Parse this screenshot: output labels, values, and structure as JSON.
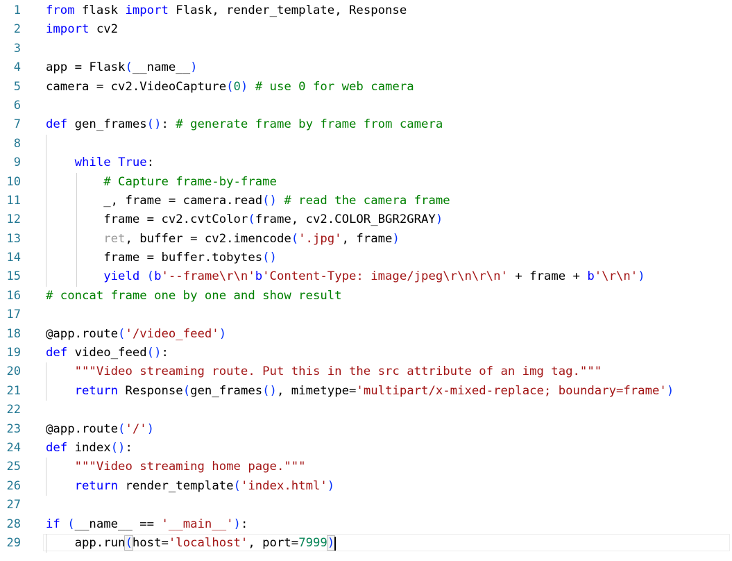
{
  "editor": {
    "lines": [
      {
        "n": "1",
        "indent": 0,
        "tokens": [
          {
            "t": "from",
            "c": "kw"
          },
          {
            "t": " flask ",
            "c": "pl"
          },
          {
            "t": "import",
            "c": "kw"
          },
          {
            "t": " Flask, render_template, Response",
            "c": "pl"
          }
        ]
      },
      {
        "n": "2",
        "indent": 0,
        "tokens": [
          {
            "t": "import",
            "c": "kw"
          },
          {
            "t": " cv2",
            "c": "pl"
          }
        ]
      },
      {
        "n": "3",
        "indent": 0,
        "tokens": []
      },
      {
        "n": "4",
        "indent": 0,
        "tokens": [
          {
            "t": "app = Flask",
            "c": "pl"
          },
          {
            "t": "(",
            "c": "br"
          },
          {
            "t": "__name__",
            "c": "pl"
          },
          {
            "t": ")",
            "c": "br"
          }
        ]
      },
      {
        "n": "5",
        "indent": 0,
        "tokens": [
          {
            "t": "camera = cv2.VideoCapture",
            "c": "pl"
          },
          {
            "t": "(",
            "c": "br"
          },
          {
            "t": "0",
            "c": "num"
          },
          {
            "t": ")",
            "c": "br"
          },
          {
            "t": " # use 0 for web camera",
            "c": "cm"
          }
        ]
      },
      {
        "n": "6",
        "indent": 0,
        "tokens": []
      },
      {
        "n": "7",
        "indent": 0,
        "tokens": [
          {
            "t": "def",
            "c": "kw"
          },
          {
            "t": " gen_frames",
            "c": "pl"
          },
          {
            "t": "()",
            "c": "br"
          },
          {
            "t": ": ",
            "c": "pl"
          },
          {
            "t": "# generate frame by frame from camera",
            "c": "cm"
          }
        ]
      },
      {
        "n": "8",
        "indent": 1,
        "tokens": []
      },
      {
        "n": "9",
        "indent": 1,
        "tokens": [
          {
            "t": "    ",
            "c": "pl"
          },
          {
            "t": "while",
            "c": "kw"
          },
          {
            "t": " ",
            "c": "pl"
          },
          {
            "t": "True",
            "c": "kw"
          },
          {
            "t": ":",
            "c": "pl"
          }
        ]
      },
      {
        "n": "10",
        "indent": 2,
        "tokens": [
          {
            "t": "        ",
            "c": "pl"
          },
          {
            "t": "# Capture frame-by-frame",
            "c": "cm"
          }
        ]
      },
      {
        "n": "11",
        "indent": 2,
        "tokens": [
          {
            "t": "        _, frame = camera.read",
            "c": "pl"
          },
          {
            "t": "()",
            "c": "br"
          },
          {
            "t": " # read the camera frame",
            "c": "cm"
          }
        ]
      },
      {
        "n": "12",
        "indent": 2,
        "tokens": [
          {
            "t": "        frame = cv2.cvtColor",
            "c": "pl"
          },
          {
            "t": "(",
            "c": "br"
          },
          {
            "t": "frame, cv2.COLOR_BGR2GRAY",
            "c": "pl"
          },
          {
            "t": ")",
            "c": "br"
          }
        ]
      },
      {
        "n": "13",
        "indent": 2,
        "tokens": [
          {
            "t": "        ",
            "c": "pl"
          },
          {
            "t": "ret",
            "c": "dim"
          },
          {
            "t": ", buffer = cv2.imencode",
            "c": "pl"
          },
          {
            "t": "(",
            "c": "br"
          },
          {
            "t": "'.jpg'",
            "c": "str"
          },
          {
            "t": ", frame",
            "c": "pl"
          },
          {
            "t": ")",
            "c": "br"
          }
        ]
      },
      {
        "n": "14",
        "indent": 2,
        "tokens": [
          {
            "t": "        frame = buffer.tobytes",
            "c": "pl"
          },
          {
            "t": "()",
            "c": "br"
          }
        ]
      },
      {
        "n": "15",
        "indent": 2,
        "tokens": [
          {
            "t": "        ",
            "c": "pl"
          },
          {
            "t": "yield",
            "c": "kw"
          },
          {
            "t": " ",
            "c": "pl"
          },
          {
            "t": "(",
            "c": "br"
          },
          {
            "t": "b",
            "c": "kw"
          },
          {
            "t": "'--frame\\r\\n'",
            "c": "str"
          },
          {
            "t": "b",
            "c": "kw"
          },
          {
            "t": "'Content-Type: image/jpeg\\r\\n\\r\\n'",
            "c": "str"
          },
          {
            "t": " + frame + ",
            "c": "pl"
          },
          {
            "t": "b",
            "c": "kw"
          },
          {
            "t": "'\\r\\n'",
            "c": "str"
          },
          {
            "t": ")",
            "c": "br"
          }
        ]
      },
      {
        "n": "16",
        "indent": 0,
        "tokens": [
          {
            "t": "# concat frame one by one and show result",
            "c": "cm"
          }
        ]
      },
      {
        "n": "17",
        "indent": 0,
        "tokens": []
      },
      {
        "n": "18",
        "indent": 0,
        "tokens": [
          {
            "t": "@app.route",
            "c": "pl"
          },
          {
            "t": "(",
            "c": "br"
          },
          {
            "t": "'/video_feed'",
            "c": "str"
          },
          {
            "t": ")",
            "c": "br"
          }
        ]
      },
      {
        "n": "19",
        "indent": 0,
        "tokens": [
          {
            "t": "def",
            "c": "kw"
          },
          {
            "t": " video_feed",
            "c": "pl"
          },
          {
            "t": "()",
            "c": "br"
          },
          {
            "t": ":",
            "c": "pl"
          }
        ]
      },
      {
        "n": "20",
        "indent": 1,
        "tokens": [
          {
            "t": "    ",
            "c": "pl"
          },
          {
            "t": "\"\"\"Video streaming route. Put this in the src attribute of an img tag.\"\"\"",
            "c": "str"
          }
        ]
      },
      {
        "n": "21",
        "indent": 1,
        "tokens": [
          {
            "t": "    ",
            "c": "pl"
          },
          {
            "t": "return",
            "c": "kw"
          },
          {
            "t": " Response",
            "c": "pl"
          },
          {
            "t": "(",
            "c": "br"
          },
          {
            "t": "gen_frames",
            "c": "pl"
          },
          {
            "t": "()",
            "c": "br"
          },
          {
            "t": ", mimetype=",
            "c": "pl"
          },
          {
            "t": "'multipart/x-mixed-replace; boundary=frame'",
            "c": "str"
          },
          {
            "t": ")",
            "c": "br"
          }
        ]
      },
      {
        "n": "22",
        "indent": 0,
        "tokens": []
      },
      {
        "n": "23",
        "indent": 0,
        "tokens": [
          {
            "t": "@app.route",
            "c": "pl"
          },
          {
            "t": "(",
            "c": "br"
          },
          {
            "t": "'/'",
            "c": "str"
          },
          {
            "t": ")",
            "c": "br"
          }
        ]
      },
      {
        "n": "24",
        "indent": 0,
        "tokens": [
          {
            "t": "def",
            "c": "kw"
          },
          {
            "t": " index",
            "c": "pl"
          },
          {
            "t": "()",
            "c": "br"
          },
          {
            "t": ":",
            "c": "pl"
          }
        ]
      },
      {
        "n": "25",
        "indent": 1,
        "tokens": [
          {
            "t": "    ",
            "c": "pl"
          },
          {
            "t": "\"\"\"Video streaming home page.\"\"\"",
            "c": "str"
          }
        ]
      },
      {
        "n": "26",
        "indent": 1,
        "tokens": [
          {
            "t": "    ",
            "c": "pl"
          },
          {
            "t": "return",
            "c": "kw"
          },
          {
            "t": " render_template",
            "c": "pl"
          },
          {
            "t": "(",
            "c": "br"
          },
          {
            "t": "'index.html'",
            "c": "str"
          },
          {
            "t": ")",
            "c": "br"
          }
        ]
      },
      {
        "n": "27",
        "indent": 0,
        "tokens": []
      },
      {
        "n": "28",
        "indent": 0,
        "tokens": [
          {
            "t": "if",
            "c": "kw"
          },
          {
            "t": " ",
            "c": "pl"
          },
          {
            "t": "(",
            "c": "br"
          },
          {
            "t": "__name__ == ",
            "c": "pl"
          },
          {
            "t": "'__main__'",
            "c": "str"
          },
          {
            "t": ")",
            "c": "br"
          },
          {
            "t": ":",
            "c": "pl"
          }
        ]
      },
      {
        "n": "29",
        "indent": 1,
        "current": true,
        "tokens": [
          {
            "t": "    app.run",
            "c": "pl"
          },
          {
            "t": "(",
            "c": "brhl"
          },
          {
            "t": "host=",
            "c": "pl"
          },
          {
            "t": "'localhost'",
            "c": "str"
          },
          {
            "t": ", port=",
            "c": "pl"
          },
          {
            "t": "7999",
            "c": "num"
          },
          {
            "t": ")",
            "c": "brhl"
          }
        ]
      }
    ]
  },
  "theme": {
    "keyword": "#0000ff",
    "string": "#a31515",
    "comment": "#008000",
    "number": "#098658",
    "line_number": "#237893",
    "bracket": "#0431fa"
  }
}
